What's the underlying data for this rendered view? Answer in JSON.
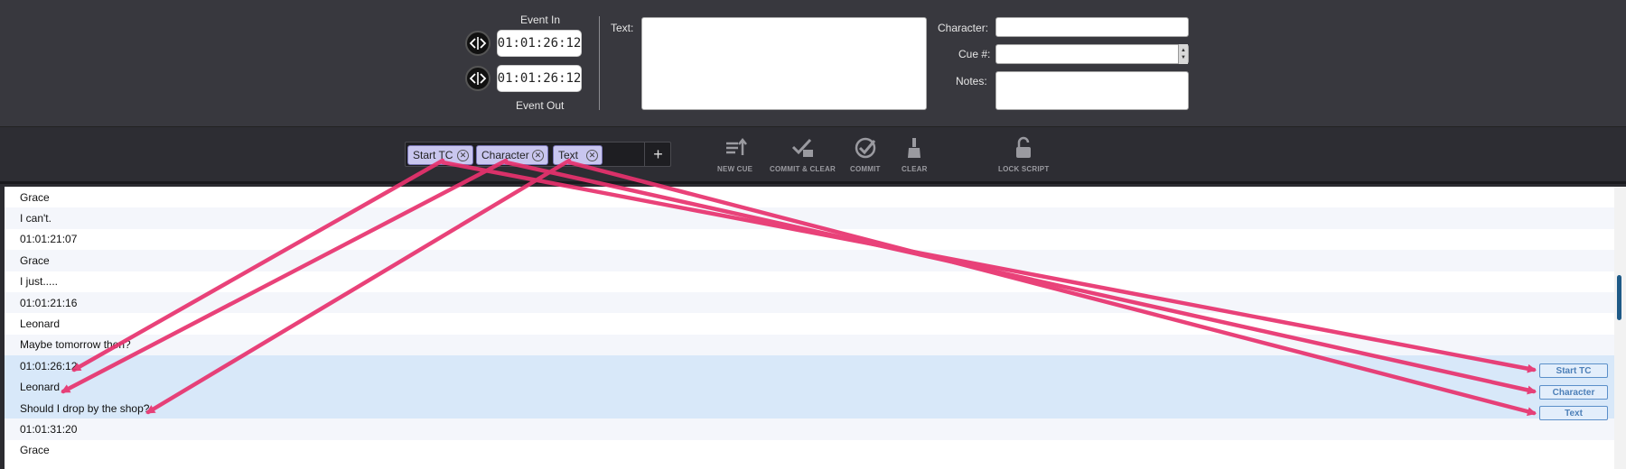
{
  "editor": {
    "event_in_label": "Event In",
    "event_in_tc": "01:01:26:12",
    "event_out_label": "Event Out",
    "event_out_tc": "01:01:26:12",
    "text_label": "Text:",
    "text_value": "",
    "character_label": "Character:",
    "character_value": "",
    "cue_label": "Cue #:",
    "cue_value": "",
    "notes_label": "Notes:",
    "notes_value": ""
  },
  "token_bar": {
    "tokens": [
      {
        "label": "Start TC"
      },
      {
        "label": "Character"
      },
      {
        "label": "Text"
      }
    ],
    "add_icon": "plus-icon"
  },
  "toolbar": {
    "new_cue": "NEW CUE",
    "commit_clear": "COMMIT & CLEAR",
    "commit": "COMMIT",
    "clear": "CLEAR",
    "lock_script": "LOCK SCRIPT"
  },
  "script_rows": [
    "Grace",
    "I can't.",
    "01:01:21:07",
    "Grace",
    "I just.....",
    "01:01:21:16",
    "Leonard",
    "Maybe tomorrow then?",
    "01:01:26:12",
    "Leonard",
    "Should I drop by the shop?",
    "01:01:31:20",
    "Grace"
  ],
  "selected_rows": [
    8,
    9,
    10
  ],
  "row_tags": {
    "start_tc": "Start TC",
    "character": "Character",
    "text": "Text"
  },
  "colors": {
    "arrow": "#e8326e",
    "token_fill": "#c9c6ef",
    "selection": "#d8e8f9",
    "tag_border": "#5b8fc9"
  }
}
